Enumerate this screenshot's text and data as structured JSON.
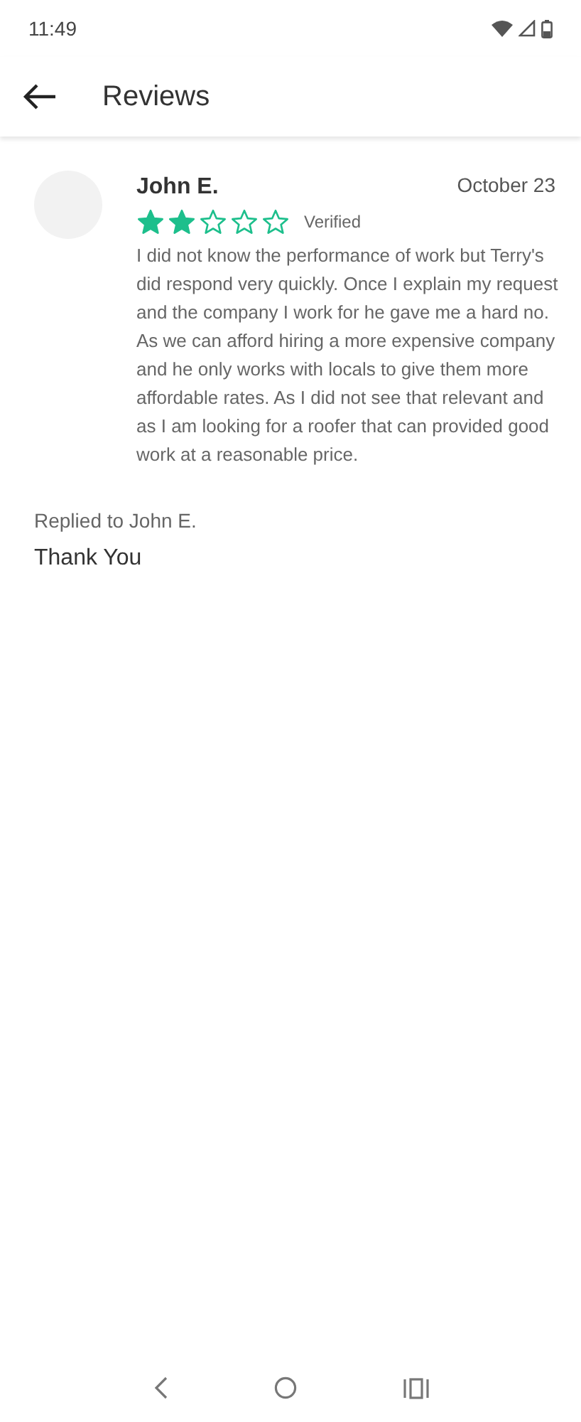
{
  "status_bar": {
    "time": "11:49"
  },
  "app_bar": {
    "title": "Reviews"
  },
  "review": {
    "author": "John E.",
    "date": "October 23",
    "stars": 2,
    "badge": "Verified",
    "body": "I did not know the performance of work but Terry's did respond very quickly. Once I explain my request and the company I work for he gave me a hard no. As we can afford hiring a more expensive company and he only works with locals to give them more affordable rates. As I did not see that relevant and as I am looking for a roofer that can provided good work at a reasonable price."
  },
  "reply": {
    "label": "Replied to John E.",
    "text": "Thank You"
  }
}
